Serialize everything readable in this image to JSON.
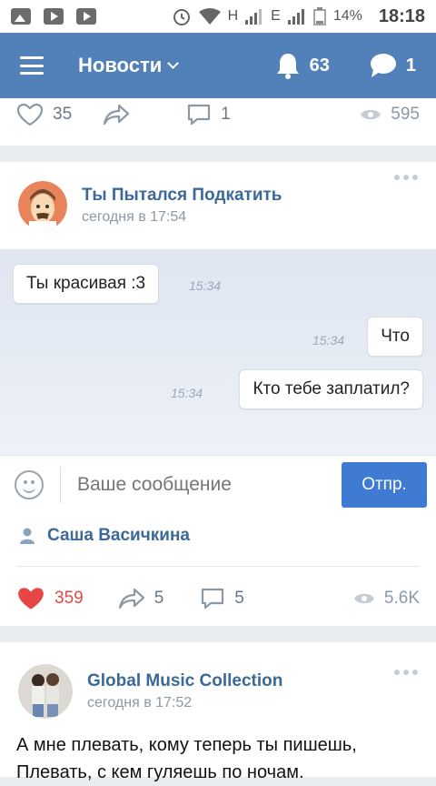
{
  "status_bar": {
    "signal1": "H",
    "signal2": "E",
    "battery": "14%",
    "time": "18:18"
  },
  "app_bar": {
    "title": "Новости",
    "notifications_count": "63",
    "messages_count": "1"
  },
  "top_post_stats": {
    "likes": "35",
    "comments": "1",
    "views": "595"
  },
  "post1": {
    "author": "Ты Пытался Подкатить",
    "date": "сегодня в 17:54",
    "chat": {
      "messages": [
        {
          "text": "Ты красивая :3",
          "time": "15:34",
          "side": "left"
        },
        {
          "text": "Что",
          "time": "15:34",
          "side": "right"
        },
        {
          "text": "Кто тебе заплатил?",
          "time": "15:34",
          "side": "right"
        }
      ],
      "input_placeholder": "Ваше сообщение",
      "send_label": "Отпр."
    },
    "signed_by": "Саша Васичкина",
    "stats": {
      "likes": "359",
      "shares": "5",
      "comments": "5",
      "views": "5.6K"
    }
  },
  "post2": {
    "author": "Global Music Collection",
    "date": "сегодня в 17:52",
    "text_line1": "А мне плевать, кому теперь ты пишешь,",
    "text_line2": "Плевать, с кем гуляешь по ночам."
  },
  "colors": {
    "accent": "#5181b8",
    "link": "#3b6998",
    "like_active": "#e64646",
    "send_button": "#3f7ad3"
  }
}
